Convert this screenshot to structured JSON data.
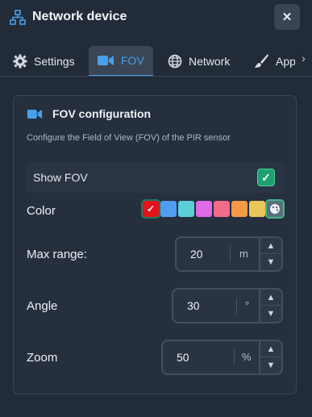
{
  "header": {
    "title": "Network device",
    "close_label": "✕"
  },
  "tabs": [
    {
      "label": "Settings",
      "icon": "gear-icon"
    },
    {
      "label": "FOV",
      "icon": "video-camera-icon"
    },
    {
      "label": "Network",
      "icon": "globe-icon"
    },
    {
      "label": "Appearance",
      "icon": "brush-icon"
    }
  ],
  "tabs_scroll_label": "›",
  "panel": {
    "title": "FOV configuration",
    "description": "Configure the Field of View (FOV) of the PIR sensor",
    "show_fov": {
      "label": "Show FOV",
      "checked": true
    },
    "color": {
      "label": "Color",
      "swatches": [
        "#e3121b",
        "#4f9ef0",
        "#5ad0d6",
        "#e06ae8",
        "#f16b8a",
        "#f39a46",
        "#e8c65a",
        "#5a6f7c"
      ],
      "selected": "#e3121b"
    },
    "max_range": {
      "label": "Max range:",
      "value": "20",
      "unit": "m"
    },
    "angle": {
      "label": "Angle",
      "value": "30",
      "unit": "°"
    },
    "zoom": {
      "label": "Zoom",
      "value": "50",
      "unit": "%"
    }
  },
  "colors": {
    "accent": "#4aa0e8",
    "check": "#1fa070",
    "background": "#222b38"
  }
}
